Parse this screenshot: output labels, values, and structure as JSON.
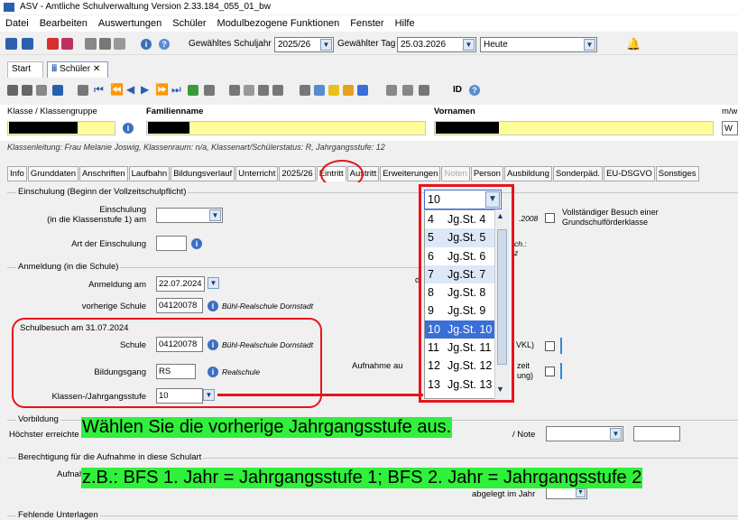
{
  "window": {
    "title": "ASV - Amtliche Schulverwaltung Version 2.33.184_055_01_bw"
  },
  "menu": [
    "Datei",
    "Bearbeiten",
    "Auswertungen",
    "Schüler",
    "Modulbezogene Funktionen",
    "Fenster",
    "Hilfe"
  ],
  "toolbar": {
    "schuljahr_label": "Gewähltes Schuljahr",
    "schuljahr_value": "2025/26",
    "tag_label": "Gewählter Tag",
    "tag_value": "25.03.2026",
    "heute_value": "Heute"
  },
  "doc_tabs": [
    {
      "label": "Start"
    },
    {
      "label": "Schüler"
    }
  ],
  "record_toolbar": {
    "id_label": "ID"
  },
  "header": {
    "klasse_label": "Klasse / Klassengruppe",
    "familienname_label": "Familienname",
    "vornamen_label": "Vornamen",
    "mw_label": "m/w",
    "mw_value": "W",
    "leitung": "Klassenleitung: Frau Melanie Joswig, Klassenraum: n/a, Klassenart/Schülerstatus: R, Jahrgangsstufe: 12"
  },
  "tabs": [
    "Info",
    "Grunddaten",
    "Anschriften",
    "Laufbahn",
    "Bildungsverlauf",
    "Unterricht",
    "2025/26",
    "Eintritt",
    "Austritt",
    "Erweiterungen",
    "Noten",
    "Person",
    "Ausbildung",
    "Sonderpäd.",
    "EU-DSGVO",
    "Sonstiges"
  ],
  "form": {
    "einschulung_section": "Einschulung (Beginn der Vollzeitschulpflicht)",
    "einschulung_label1": "Einschulung",
    "einschulung_label2": "(in die Klassenstufe 1) am",
    "einschulung_year_hint": ".2008",
    "vollst_label1": "Vollständiger Besuch einer",
    "vollst_label2": "Grundschulförderklasse",
    "art_label": "Art der Einschulung",
    "fach_hint1": "ch.:",
    "fach_hint2": "z",
    "anmeldung_section": "Anmeldung (in die Schule)",
    "anmeldung_label": "Anmeldung am",
    "anmeldung_value": "22.07.2024",
    "vorherige_label": "vorherige Schule",
    "vorherige_value": "04120078",
    "vorherige_name": "Bühl-Realschule Dornstadt",
    "schulbesuch_section": "Schulbesuch am 31.07.2024",
    "schule_label": "Schule",
    "schule_value": "04120078",
    "schule_name": "Bühl-Realschule Dornstadt",
    "bildungsgang_label": "Bildungsgang",
    "bildungsgang_value": "RS",
    "bildungsgang_name": "Realschule",
    "klassen_label": "Klassen-/Jahrgangsstufe",
    "klassen_value": "10",
    "vkl_hint": "VKL)",
    "aufnahme_label": "Aufnahme au",
    "zeit_hint1": "zeit",
    "zeit_hint2": "ung)",
    "vorbildung_section": "Vorbildung",
    "hoechster_label": "Höchster erreichte",
    "note_label": "/ Note",
    "berechtigung_section": "Berechtigung für die Aufnahme in diese Schulart",
    "aufnah_label": "Aufnah",
    "abgelegt_label": "abgelegt im Jahr",
    "fehlende_section": "Fehlende Unterlagen"
  },
  "dropdown": {
    "selected": "10",
    "items": [
      {
        "n": "4",
        "label": "Jg.St. 4"
      },
      {
        "n": "5",
        "label": "Jg.St. 5"
      },
      {
        "n": "6",
        "label": "Jg.St. 6"
      },
      {
        "n": "7",
        "label": "Jg.St. 7"
      },
      {
        "n": "8",
        "label": "Jg.St. 8"
      },
      {
        "n": "9",
        "label": "Jg.St. 9"
      },
      {
        "n": "10",
        "label": "Jg.St. 10"
      },
      {
        "n": "11",
        "label": "Jg.St. 11"
      },
      {
        "n": "12",
        "label": "Jg.St. 12"
      },
      {
        "n": "13",
        "label": "Jg.St. 13"
      }
    ]
  },
  "annotations": {
    "line1": "Wählen Sie die vorherige Jahrgangsstufe aus.",
    "line2": "z.B.: BFS 1. Jahr = Jahrgangsstufe 1; BFS 2. Jahr = Jahrgangsstufe 2"
  },
  "colors": {
    "highlight_red": "#e8141c",
    "annotation_green": "#2ff03a",
    "selection_blue": "#3a6fd8"
  }
}
